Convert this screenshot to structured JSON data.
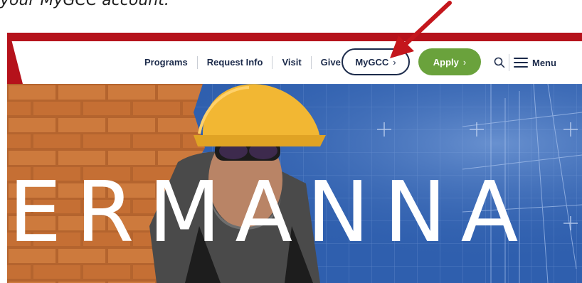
{
  "caption": {
    "text": "your MyGCC account."
  },
  "nav": {
    "links": [
      {
        "label": "Programs"
      },
      {
        "label": "Request Info"
      },
      {
        "label": "Visit"
      },
      {
        "label": "Give"
      }
    ],
    "mygcc_label": "MyGCC",
    "apply_label": "Apply",
    "menu_label": "Menu",
    "chevron": "›"
  },
  "hero": {
    "wordmark": "ERMANNA"
  },
  "colors": {
    "frame": "#b5121b",
    "navy": "#1b2a4a",
    "apply": "#6aa23c",
    "hero_blue": "#2f5fae",
    "arrow": "#c4161c"
  },
  "icons": [
    "search-icon",
    "hamburger-menu-icon",
    "chevron-right-icon",
    "annotation-arrow-icon"
  ]
}
